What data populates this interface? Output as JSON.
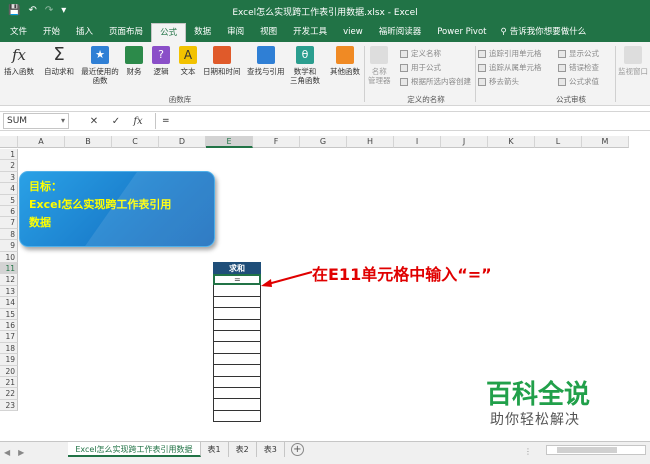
{
  "window": {
    "title": "Excel怎么实现跨工作表引用数据.xlsx  -  Excel"
  },
  "quick_access": {
    "save": "💾",
    "undo": "↶",
    "redo": "↷",
    "customize": "▾"
  },
  "tabs": [
    "文件",
    "开始",
    "插入",
    "页面布局",
    "公式",
    "数据",
    "审阅",
    "视图",
    "开发工具",
    "view",
    "福昕阅读器",
    "Power Pivot"
  ],
  "active_tab": "公式",
  "tell_me": "告诉我你想要做什么",
  "ribbon": {
    "insert_function": "插入函数",
    "autosum": "自动求和",
    "recent": "最近使用的\n函数",
    "financial": "财务",
    "logical": "逻辑",
    "text": "文本",
    "datetime": "日期和时间",
    "lookup": "查找与引用",
    "math": "数学和\n三角函数",
    "more": "其他函数",
    "group_library": "函数库",
    "name_manager": "名称\n管理器",
    "define_name": "定义名称",
    "use_in_formula": "用于公式",
    "create_from_selection": "根据所选内容创建",
    "group_names": "定义的名称",
    "trace_precedents": "追踪引用单元格",
    "trace_dependents": "追踪从属单元格",
    "remove_arrows": "移去箭头",
    "show_formulas": "显示公式",
    "error_checking": "错误检查",
    "evaluate_formula": "公式求值",
    "group_audit": "公式审核",
    "watch_window": "监视窗口"
  },
  "formula_bar": {
    "name_box": "SUM",
    "cancel": "✕",
    "enter": "✓",
    "fx": "fx",
    "content": "="
  },
  "columns": [
    "A",
    "B",
    "C",
    "D",
    "E",
    "F",
    "G",
    "H",
    "I",
    "J",
    "K",
    "L",
    "M"
  ],
  "selected_column": "E",
  "rows": [
    "1",
    "2",
    "3",
    "4",
    "5",
    "6",
    "7",
    "8",
    "9",
    "10",
    "11",
    "12",
    "13",
    "14",
    "15",
    "16",
    "17",
    "18",
    "19",
    "20",
    "21",
    "22",
    "23"
  ],
  "selected_row": "11",
  "goal_box": {
    "line1": "目标：",
    "line2": "Excel怎么实现跨工作表引用",
    "line3": "数据"
  },
  "table": {
    "header": "求和",
    "active_cell_value": "="
  },
  "annotation": "在E11单元格中输入“=”",
  "watermark": {
    "line1": "百科全说",
    "line2": "助你轻松解决"
  },
  "sheets": [
    "Excel怎么实现跨工作表引用数据",
    "表1",
    "表2",
    "表3"
  ],
  "active_sheet": "Excel怎么实现跨工作表引用数据",
  "add_sheet": "+",
  "colors": {
    "excel_green": "#217346",
    "annotation_red": "#e00000",
    "goal_text": "#ffff00",
    "header_navy": "#1f4e79",
    "watermark_green": "#21a04a"
  }
}
